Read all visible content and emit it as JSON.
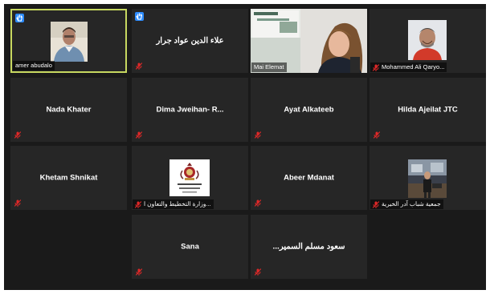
{
  "participants": [
    {
      "id": "amer",
      "label": "amer abudalo",
      "center_name": "",
      "hand_raised": true,
      "active": true
    },
    {
      "id": "alaa",
      "label": "",
      "center_name": "علاء الدين عواد جرار",
      "hand_raised": true,
      "active": false
    },
    {
      "id": "mai",
      "label": "Mai Elemat",
      "center_name": "",
      "hand_raised": false,
      "active": false
    },
    {
      "id": "mohammed",
      "label": "Mohammed Ali Qaryo...",
      "center_name": "",
      "hand_raised": false,
      "active": false
    },
    {
      "id": "nada",
      "label": "",
      "center_name": "Nada Khater",
      "hand_raised": false,
      "active": false
    },
    {
      "id": "dima",
      "label": "",
      "center_name": "Dima Jweihan- R...",
      "hand_raised": false,
      "active": false
    },
    {
      "id": "ayat",
      "label": "",
      "center_name": "Ayat Alkateeb",
      "hand_raised": false,
      "active": false
    },
    {
      "id": "hilda",
      "label": "",
      "center_name": "Hilda Ajeilat JTC",
      "hand_raised": false,
      "active": false
    },
    {
      "id": "khetam",
      "label": "",
      "center_name": "Khetam Shnikat",
      "hand_raised": false,
      "active": false
    },
    {
      "id": "ministry",
      "label": "وزارة التخطيط والتعاون ا...",
      "center_name": "",
      "hand_raised": false,
      "active": false
    },
    {
      "id": "abeer",
      "label": "",
      "center_name": "Abeer Mdanat",
      "hand_raised": false,
      "active": false
    },
    {
      "id": "adar",
      "label": "جمعية شباب آدر الخيرية",
      "center_name": "",
      "hand_raised": false,
      "active": false
    },
    {
      "id": "sana",
      "label": "",
      "center_name": "Sana",
      "hand_raised": false,
      "active": false
    },
    {
      "id": "saud",
      "label": "",
      "center_name": "...سعود مسلم السمير",
      "hand_raised": false,
      "active": false
    }
  ],
  "colors": {
    "tile": "#262626",
    "background": "#1a1a1a",
    "active_border": "#c7d860",
    "hand": "#2d8cff",
    "muted": "#e02828"
  },
  "icons": {
    "hand": "raised-hand-icon",
    "mic": "muted-mic-icon"
  }
}
